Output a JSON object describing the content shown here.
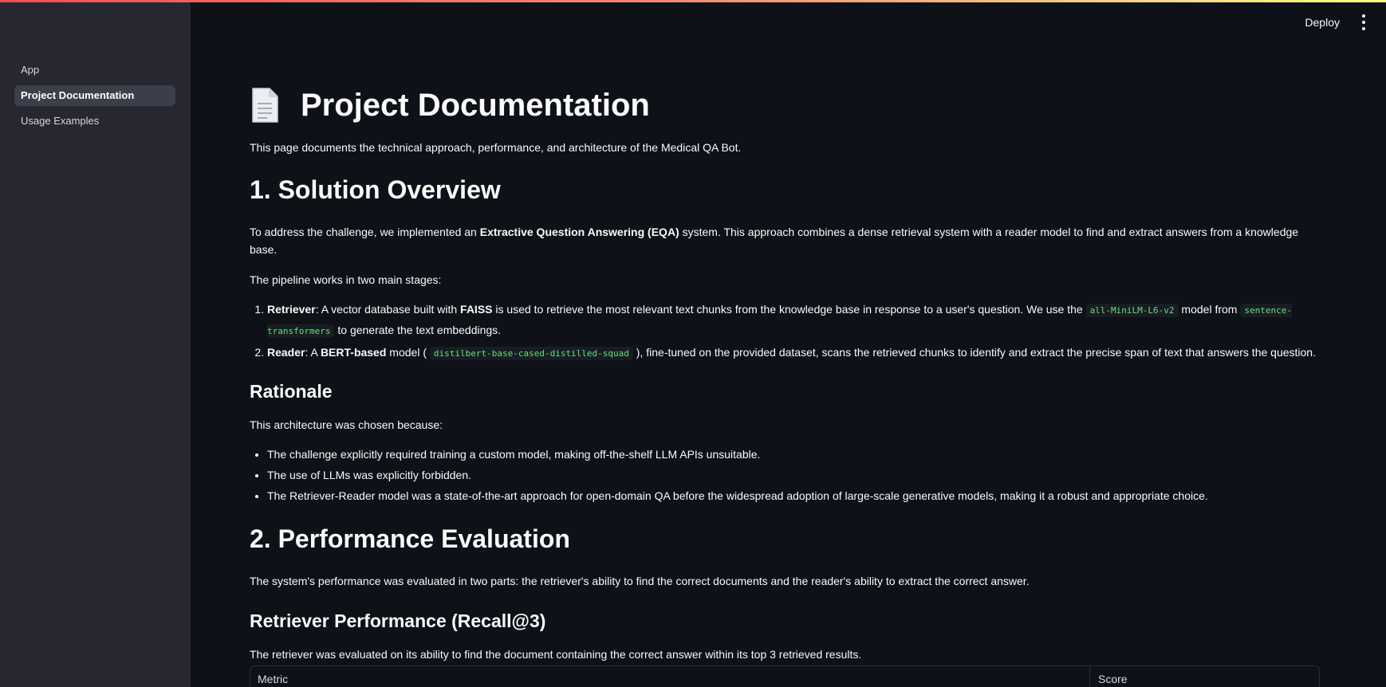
{
  "sidebar": {
    "items": [
      {
        "label": "App"
      },
      {
        "label": "Project Documentation"
      },
      {
        "label": "Usage Examples"
      }
    ]
  },
  "header": {
    "deploy_label": "Deploy"
  },
  "page": {
    "title": "Project Documentation",
    "intro": "This page documents the technical approach, performance, and architecture of the Medical QA Bot.",
    "s1": {
      "heading": "1. Solution Overview",
      "p1_a": "To address the challenge, we implemented an ",
      "p1_b": "Extractive Question Answering (EQA)",
      "p1_c": " system. This approach combines a dense retrieval system with a reader model to find and extract answers from a knowledge base.",
      "p2": "The pipeline works in two main stages:",
      "li1_a": "Retriever",
      "li1_b": ": A vector database built with ",
      "li1_c": "FAISS",
      "li1_d": " is used to retrieve the most relevant text chunks from the knowledge base in response to a user's question. We use the ",
      "li1_code1": "all-MiniLM-L6-v2",
      "li1_e": " model from ",
      "li1_code2": "sentence-transformers",
      "li1_f": " to generate the text embeddings.",
      "li2_a": "Reader",
      "li2_b": ": A ",
      "li2_c": "BERT-based",
      "li2_d": " model ( ",
      "li2_code": "distilbert-base-cased-distilled-squad",
      "li2_e": " ), fine-tuned on the provided dataset, scans the retrieved chunks to identify and extract the precise span of text that answers the question."
    },
    "rationale": {
      "heading": "Rationale",
      "intro": "This architecture was chosen because:",
      "bullets": [
        "The challenge explicitly required training a custom model, making off-the-shelf LLM APIs unsuitable.",
        "The use of LLMs was explicitly forbidden.",
        "The Retriever-Reader model was a state-of-the-art approach for open-domain QA before the widespread adoption of large-scale generative models, making it a robust and appropriate choice."
      ]
    },
    "s2": {
      "heading": "2. Performance Evaluation",
      "p1": "The system's performance was evaluated in two parts: the retriever's ability to find the correct documents and the reader's ability to extract the correct answer.",
      "sub_heading": "Retriever Performance (Recall@3)",
      "sub_p": "The retriever was evaluated on its ability to find the document containing the correct answer within its top 3 retrieved results."
    },
    "table": {
      "col_metric": "Metric",
      "col_score": "Score"
    }
  }
}
